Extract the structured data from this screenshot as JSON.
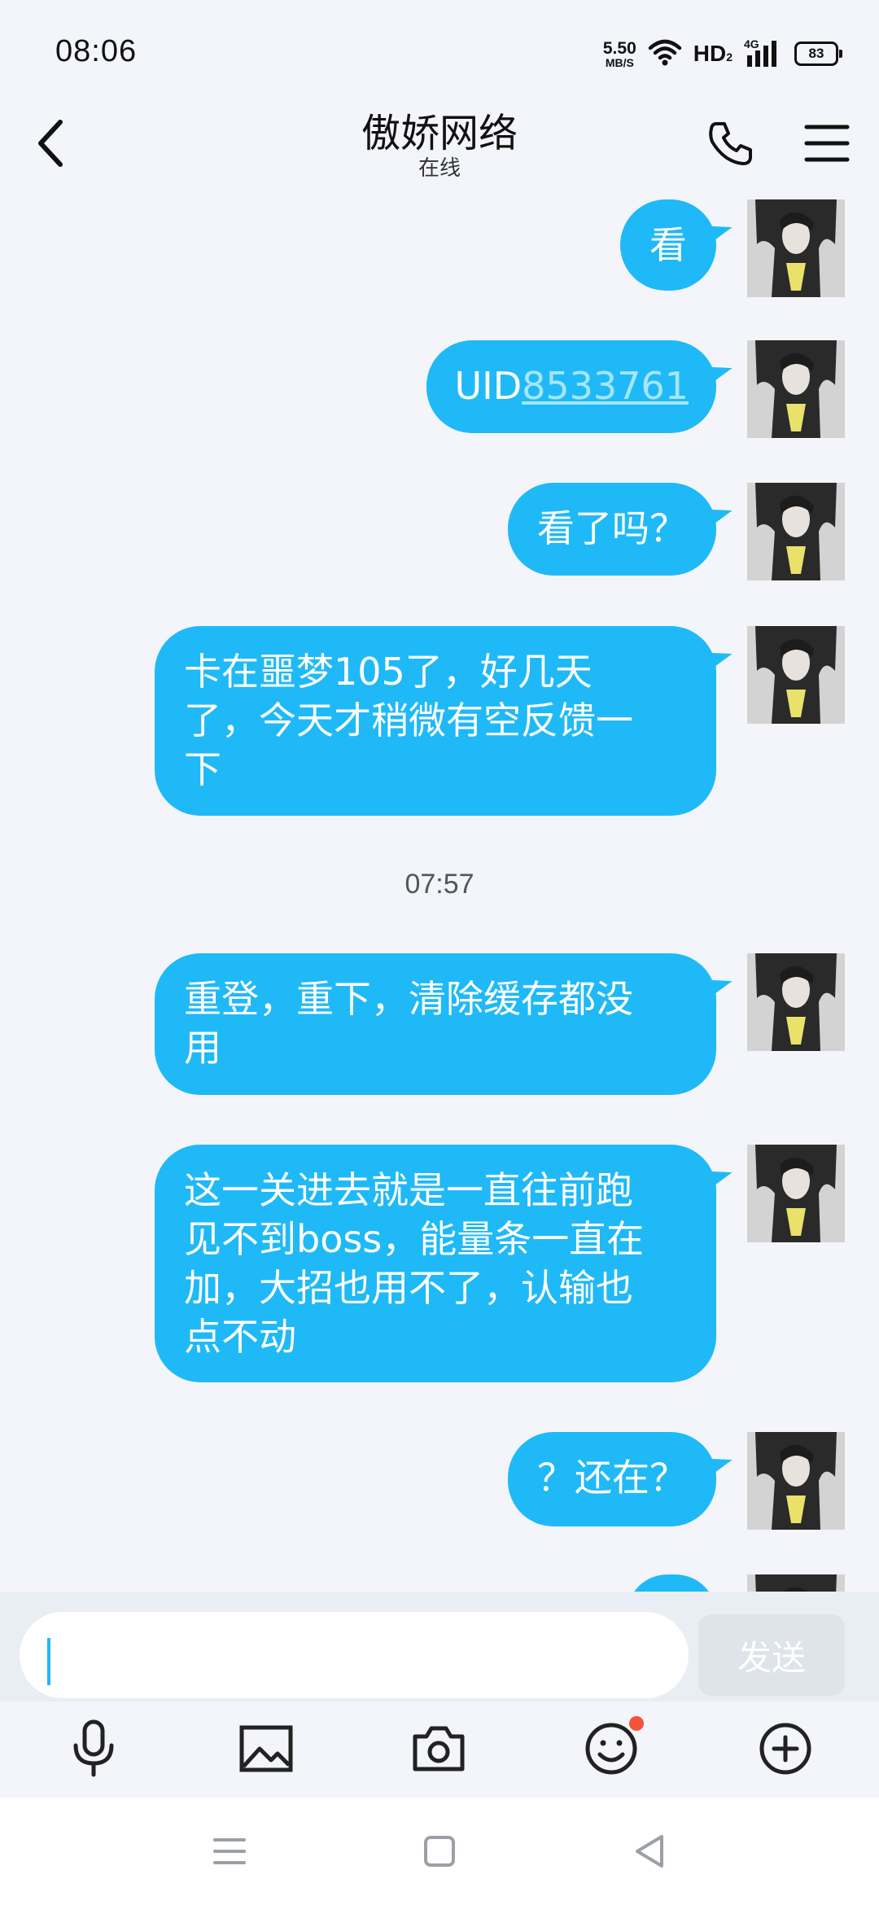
{
  "status_bar": {
    "time": "08:06",
    "net_speed_value": "5.50",
    "net_speed_unit": "MB/S",
    "hd_label": "HD",
    "hd_sub": "2",
    "network_type": "4G",
    "battery_level": "83"
  },
  "header": {
    "title": "傲娇网络",
    "subtitle": "在线"
  },
  "messages": [
    {
      "text": "看"
    },
    {
      "prefix": "UID",
      "link": "8533761"
    },
    {
      "text": "看了吗？"
    },
    {
      "lines": [
        "卡在噩梦105了，好几天",
        "了，今天才稍微有空反馈一",
        "下"
      ]
    },
    {
      "lines": [
        "重登，重下，清除缓存都没",
        "用"
      ]
    },
    {
      "lines": [
        "这一关进去就是一直往前跑",
        "见不到boss，能量条一直在",
        "加，大招也用不了，认输也",
        "点不动"
      ]
    },
    {
      "text": "？还在？"
    }
  ],
  "time_separator": "07:57",
  "composer": {
    "input_value": "",
    "send_label": "发送"
  },
  "toolbar": {
    "items": [
      "microphone-icon",
      "image-icon",
      "camera-icon",
      "emoji-icon",
      "plus-icon"
    ]
  },
  "colors": {
    "bubble": "#1fb9f7",
    "link": "#a6e6ff",
    "background": "#f3f5fa",
    "badge": "#f4523b"
  }
}
